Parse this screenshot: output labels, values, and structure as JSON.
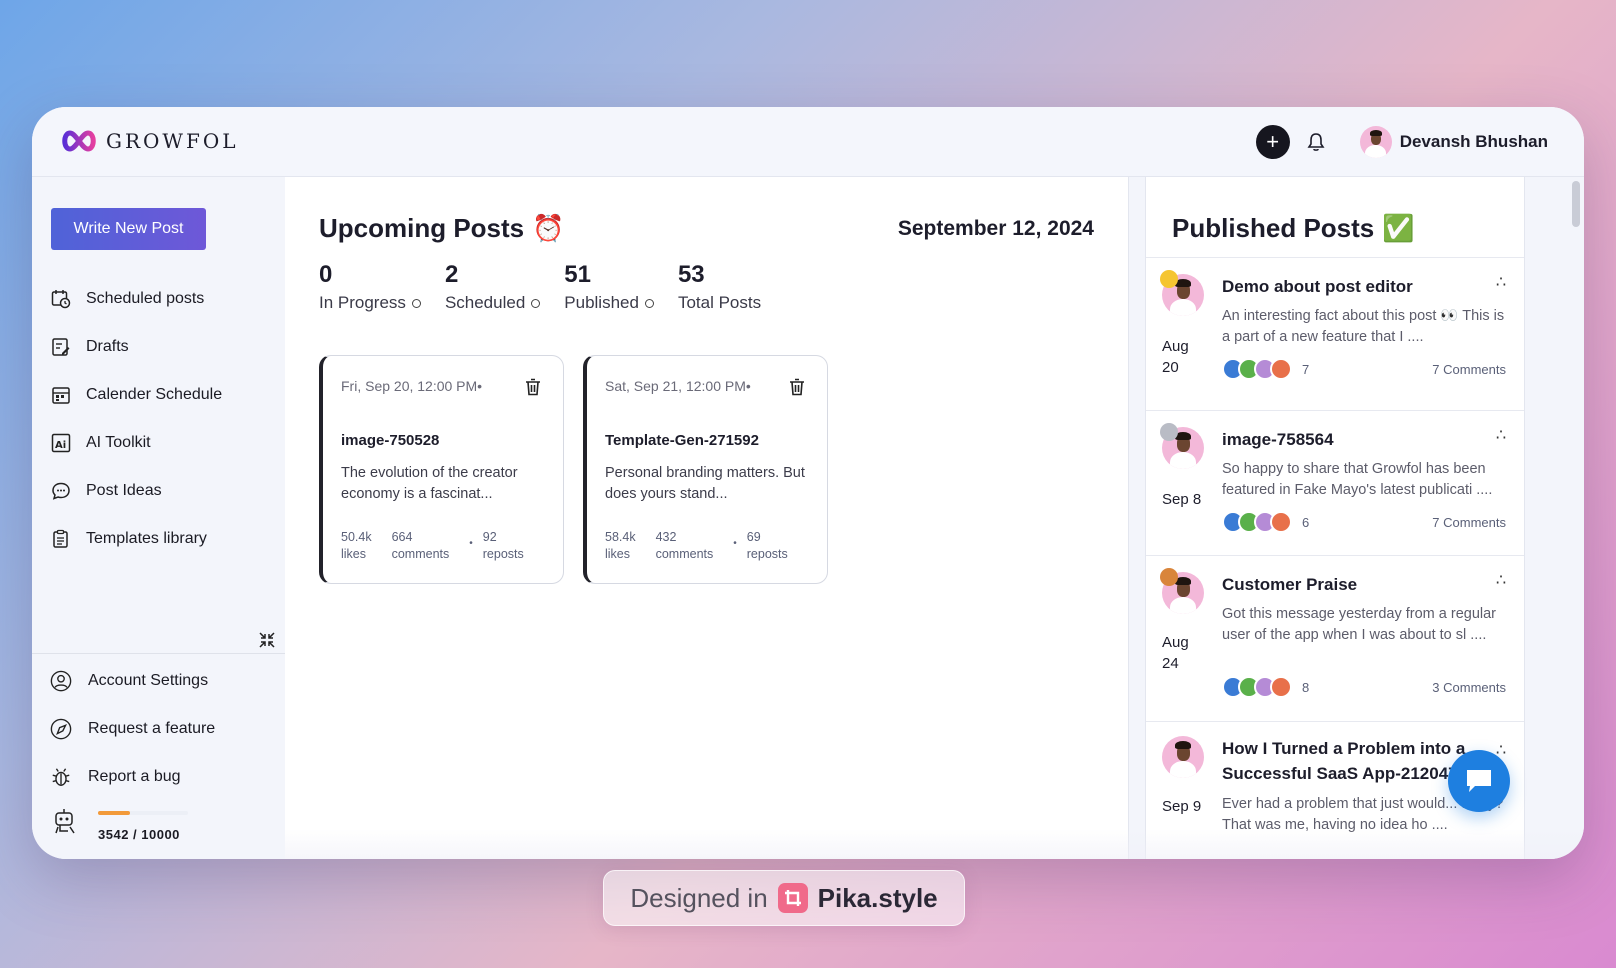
{
  "app": {
    "logo_text": "GROWFOL",
    "user_name": "Devansh Bhushan"
  },
  "sidebar": {
    "write_button": "Write New Post",
    "items": [
      {
        "label": "Scheduled posts",
        "icon": "calendar-clock-icon"
      },
      {
        "label": "Drafts",
        "icon": "edit-document-icon"
      },
      {
        "label": "Calender Schedule",
        "icon": "calendar-icon"
      },
      {
        "label": "AI Toolkit",
        "icon": "ai-icon"
      },
      {
        "label": "Post Ideas",
        "icon": "chat-bubble-icon"
      },
      {
        "label": "Templates library",
        "icon": "clipboard-icon"
      }
    ],
    "bottom_items": [
      {
        "label": "Account Settings",
        "icon": "user-circle-icon"
      },
      {
        "label": "Request a feature",
        "icon": "compass-icon"
      },
      {
        "label": "Report a bug",
        "icon": "bug-icon"
      }
    ],
    "credits": {
      "text": "3542 / 10000",
      "used": 3542,
      "total": 10000
    }
  },
  "main": {
    "title": "Upcoming Posts",
    "title_emoji": "⏰",
    "date": "September 12, 2024",
    "stats": [
      {
        "value": "0",
        "label": "In Progress"
      },
      {
        "value": "2",
        "label": "Scheduled"
      },
      {
        "value": "51",
        "label": "Published"
      },
      {
        "value": "53",
        "label": "Total Posts"
      }
    ],
    "cards": [
      {
        "date": "Fri, Sep 20, 12:00 PM•",
        "title": "image-750528",
        "desc": "The evolution of the creator economy is a fascinat...",
        "likes": "50.4k",
        "likes_label": "likes",
        "comments": "664",
        "comments_label": "comments",
        "reposts": "92",
        "reposts_label": "reposts"
      },
      {
        "date": "Sat, Sep 21, 12:00 PM•",
        "title": "Template-Gen-271592",
        "desc": "Personal branding matters. But does yours stand...",
        "likes": "58.4k",
        "likes_label": "likes",
        "comments": "432",
        "comments_label": "comments",
        "reposts": "69",
        "reposts_label": "reposts"
      }
    ]
  },
  "published": {
    "title": "Published Posts",
    "title_emoji": "✅",
    "posts": [
      {
        "month": "Aug",
        "day": "20",
        "title": "Demo about post editor",
        "desc": "An interesting fact about this post 👀 This is a part of a new feature that I ....",
        "reactions": "7",
        "comments": "7 Comments",
        "badge_color": "#f5c531"
      },
      {
        "month": "Sep",
        "day": "8",
        "title": "image-758564",
        "desc": "So happy to share that Growfol has been featured in Fake Mayo's latest publicati ....",
        "reactions": "6",
        "comments": "7 Comments",
        "badge_color": "#b9bcc5"
      },
      {
        "month": "Aug",
        "day": "24",
        "title": "Customer Praise",
        "desc": "Got this message yesterday from a regular user of the app when I was about to sl ....",
        "reactions": "8",
        "comments": "3 Comments",
        "badge_color": "#d9853b"
      },
      {
        "month": "Sep",
        "day": "9",
        "title": "How I Turned a Problem into a Successful SaaS App-212047",
        "desc": "Ever had a problem that just would... away? That was me, having no idea ho ....",
        "reactions": "",
        "comments": "",
        "badge_color": ""
      }
    ]
  },
  "watermark": {
    "prefix": "Designed in",
    "brand": "Pika.style"
  },
  "colors": {
    "accent": "#5a5fd8",
    "chat": "#1e7fe0",
    "credit_fill": "#f29a3a"
  }
}
